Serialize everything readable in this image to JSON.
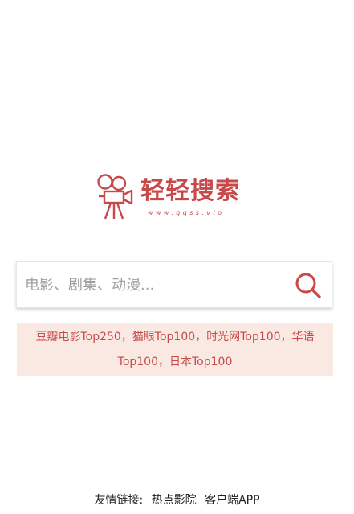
{
  "logo": {
    "title": "轻轻搜索",
    "url": "www.qqss.vip",
    "icon": "film-camera-icon",
    "color": "#c8494a"
  },
  "search": {
    "placeholder": "电影、剧集、动漫...",
    "value": "",
    "button_icon": "search-icon"
  },
  "hot_links": {
    "background": "#f9e9e2",
    "line1": [
      {
        "label": "豆瓣电影Top250",
        "sep": "，"
      },
      {
        "label": "猫眼Top100",
        "sep": "，"
      },
      {
        "label": "时光网Top100",
        "sep": "，"
      },
      {
        "label": "华语",
        "sep": ""
      }
    ],
    "line2": [
      {
        "label": "Top100",
        "sep": "，"
      },
      {
        "label": "日本Top100",
        "sep": ""
      }
    ]
  },
  "footer": {
    "label": "友情链接:",
    "links": [
      "热点影院",
      "客户端APP"
    ]
  }
}
